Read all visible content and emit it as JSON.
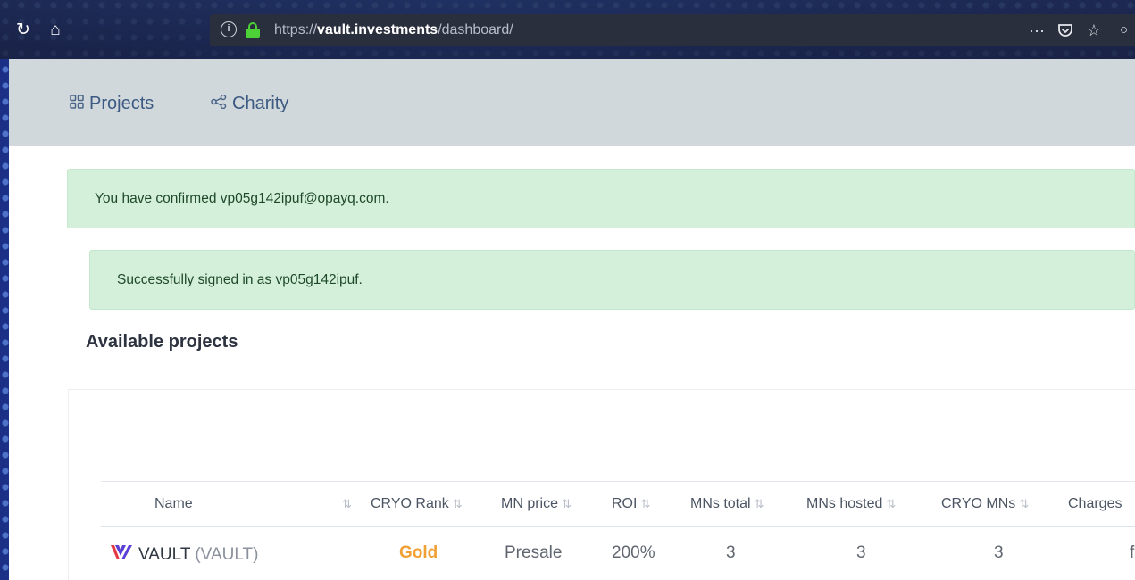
{
  "browser": {
    "url_scheme": "https://",
    "url_domain": "vault.investments",
    "url_path": "/dashboard/",
    "more_glyph": "···"
  },
  "nav": {
    "projects": "Projects",
    "charity": "Charity"
  },
  "alerts": {
    "confirmed": "You have confirmed vp05g142ipuf@opayq.com.",
    "signed_in": "Successfully signed in as vp05g142ipuf."
  },
  "section_title": "Available projects",
  "table": {
    "headers": [
      "Name",
      "CRYO Rank",
      "MN price",
      "ROI",
      "MNs total",
      "MNs hosted",
      "CRYO MNs",
      "Charges"
    ],
    "rows": [
      {
        "name": "VAULT",
        "ticker": "(VAULT)",
        "cryo_rank": "Gold",
        "mn_price": "Presale",
        "roi": "200%",
        "mns_total": "3",
        "mns_hosted": "3",
        "cryo_mns": "3",
        "charges": "f"
      }
    ]
  },
  "colors": {
    "rank_gold": "#f2a033",
    "lock_green": "#4cd137",
    "alert_bg": "#d5f0da",
    "navbar_bg": "#d1d8db",
    "logo_red": "#e53945",
    "logo_purple": "#5b3fd6"
  }
}
